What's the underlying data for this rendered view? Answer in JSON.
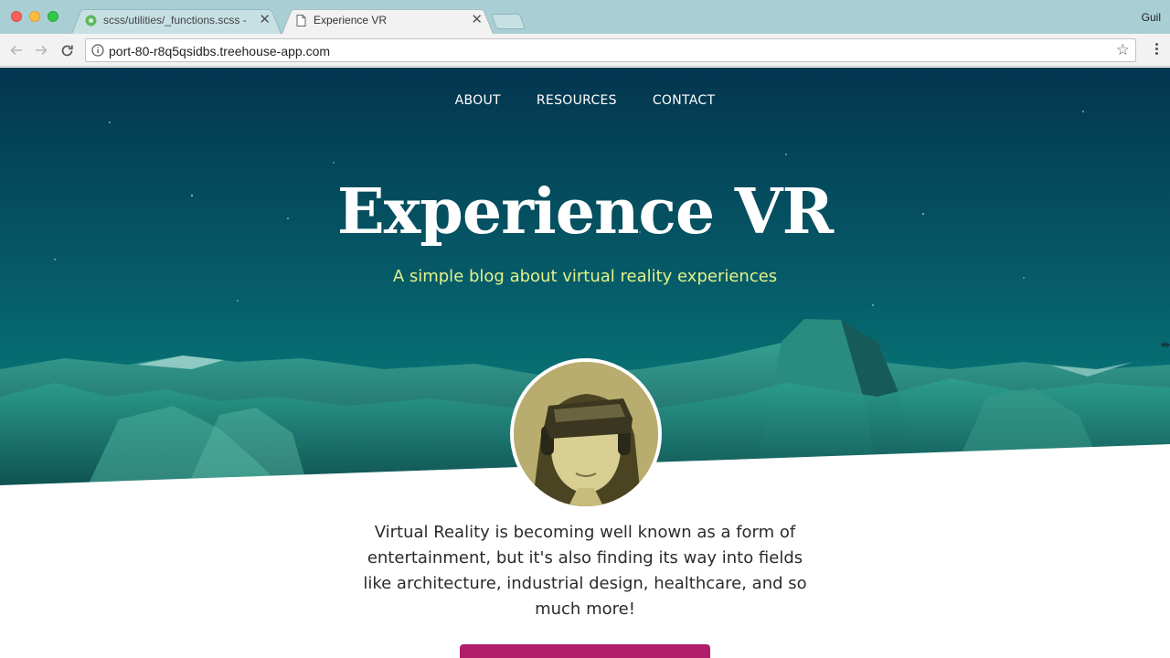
{
  "browser": {
    "tabs": [
      {
        "title": "scss/utilities/_functions.scss -",
        "active": false
      },
      {
        "title": "Experience VR",
        "active": true
      }
    ],
    "close_glyph": "✕",
    "profile_name": "Guil",
    "url": "port-80-r8q5qsidbs.treehouse-app.com",
    "icons": {
      "back": "arrow-left-icon",
      "forward": "arrow-right-icon",
      "reload": "reload-icon",
      "info": "info-icon",
      "bookmark": "star-icon",
      "menu": "kebab-menu-icon"
    }
  },
  "site": {
    "nav": [
      "ABOUT",
      "RESOURCES",
      "CONTACT"
    ],
    "title": "Experience VR",
    "subtitle": "A simple blog about virtual reality experiences",
    "intro": "Virtual Reality is becoming well known as a form of entertainment, but it's also finding its way into fields like architecture, industrial design, healthcare, and so much more!",
    "colors": {
      "hero_top": "#03354f",
      "hero_bottom": "#0a8a80",
      "subtitle": "#e3f28a",
      "cta": "#b01e6b"
    }
  }
}
